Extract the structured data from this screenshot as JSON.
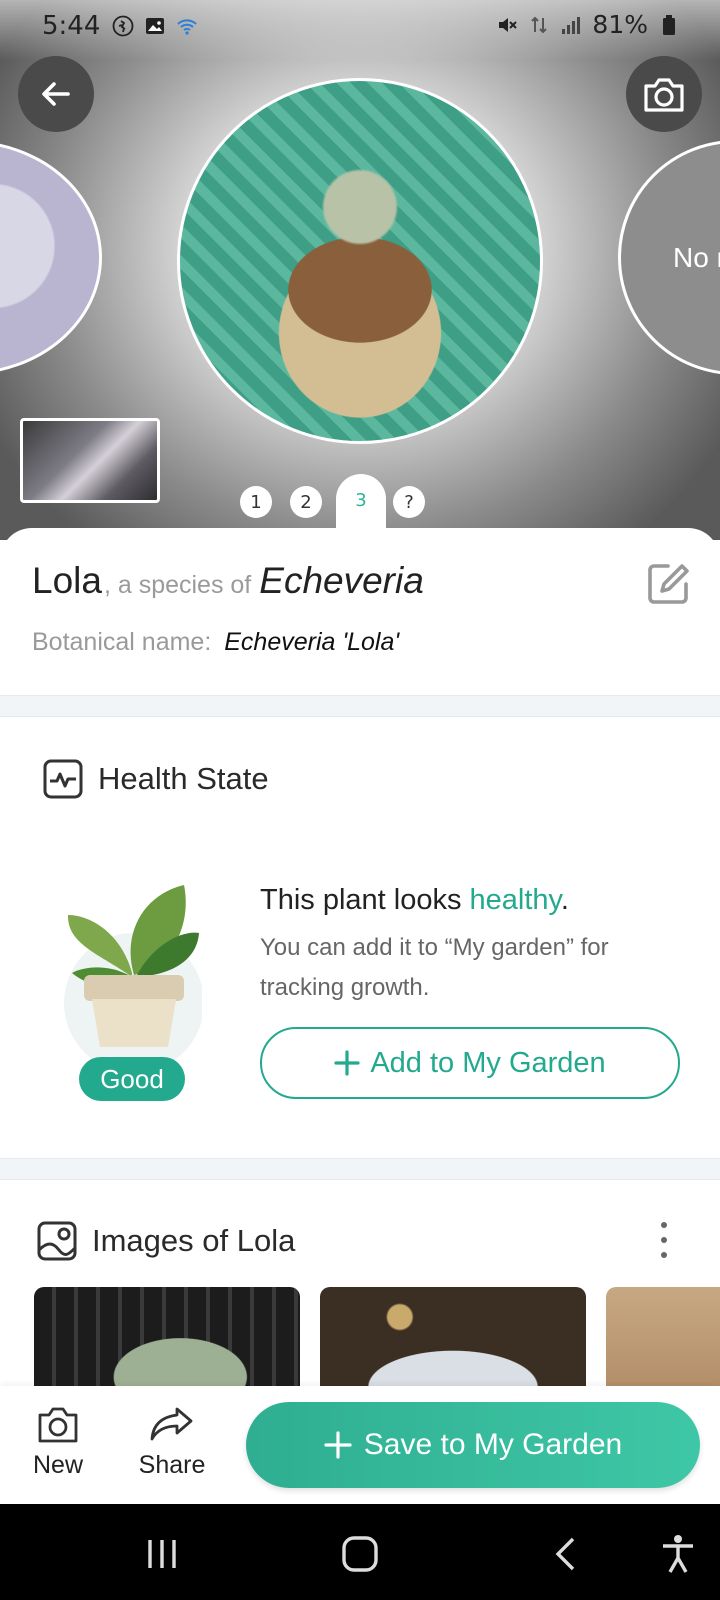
{
  "status_bar": {
    "time": "5:44",
    "battery": "81%"
  },
  "hero": {
    "right_photo_text": "No r",
    "pager": [
      "1",
      "2",
      "3",
      "?"
    ],
    "active_page": "3"
  },
  "plant": {
    "name": "Lola",
    "species_of": ", a species of",
    "genus": "Echeveria",
    "botanical_label": "Botanical name:",
    "botanical_value": "Echeveria 'Lola'"
  },
  "health": {
    "title": "Health State",
    "headline_prefix": "This plant looks ",
    "headline_status": "healthy",
    "headline_suffix": ".",
    "description": "You can add it to “My garden” for tracking growth.",
    "badge": "Good",
    "add_button": "Add to My Garden"
  },
  "images": {
    "title": "Images of Lola"
  },
  "bottom_bar": {
    "new_label": "New",
    "share_label": "Share",
    "save_label": "Save to My Garden"
  },
  "colors": {
    "accent": "#23a98e",
    "save_gradient_start": "#2fae91",
    "save_gradient_end": "#3ec7a6"
  }
}
